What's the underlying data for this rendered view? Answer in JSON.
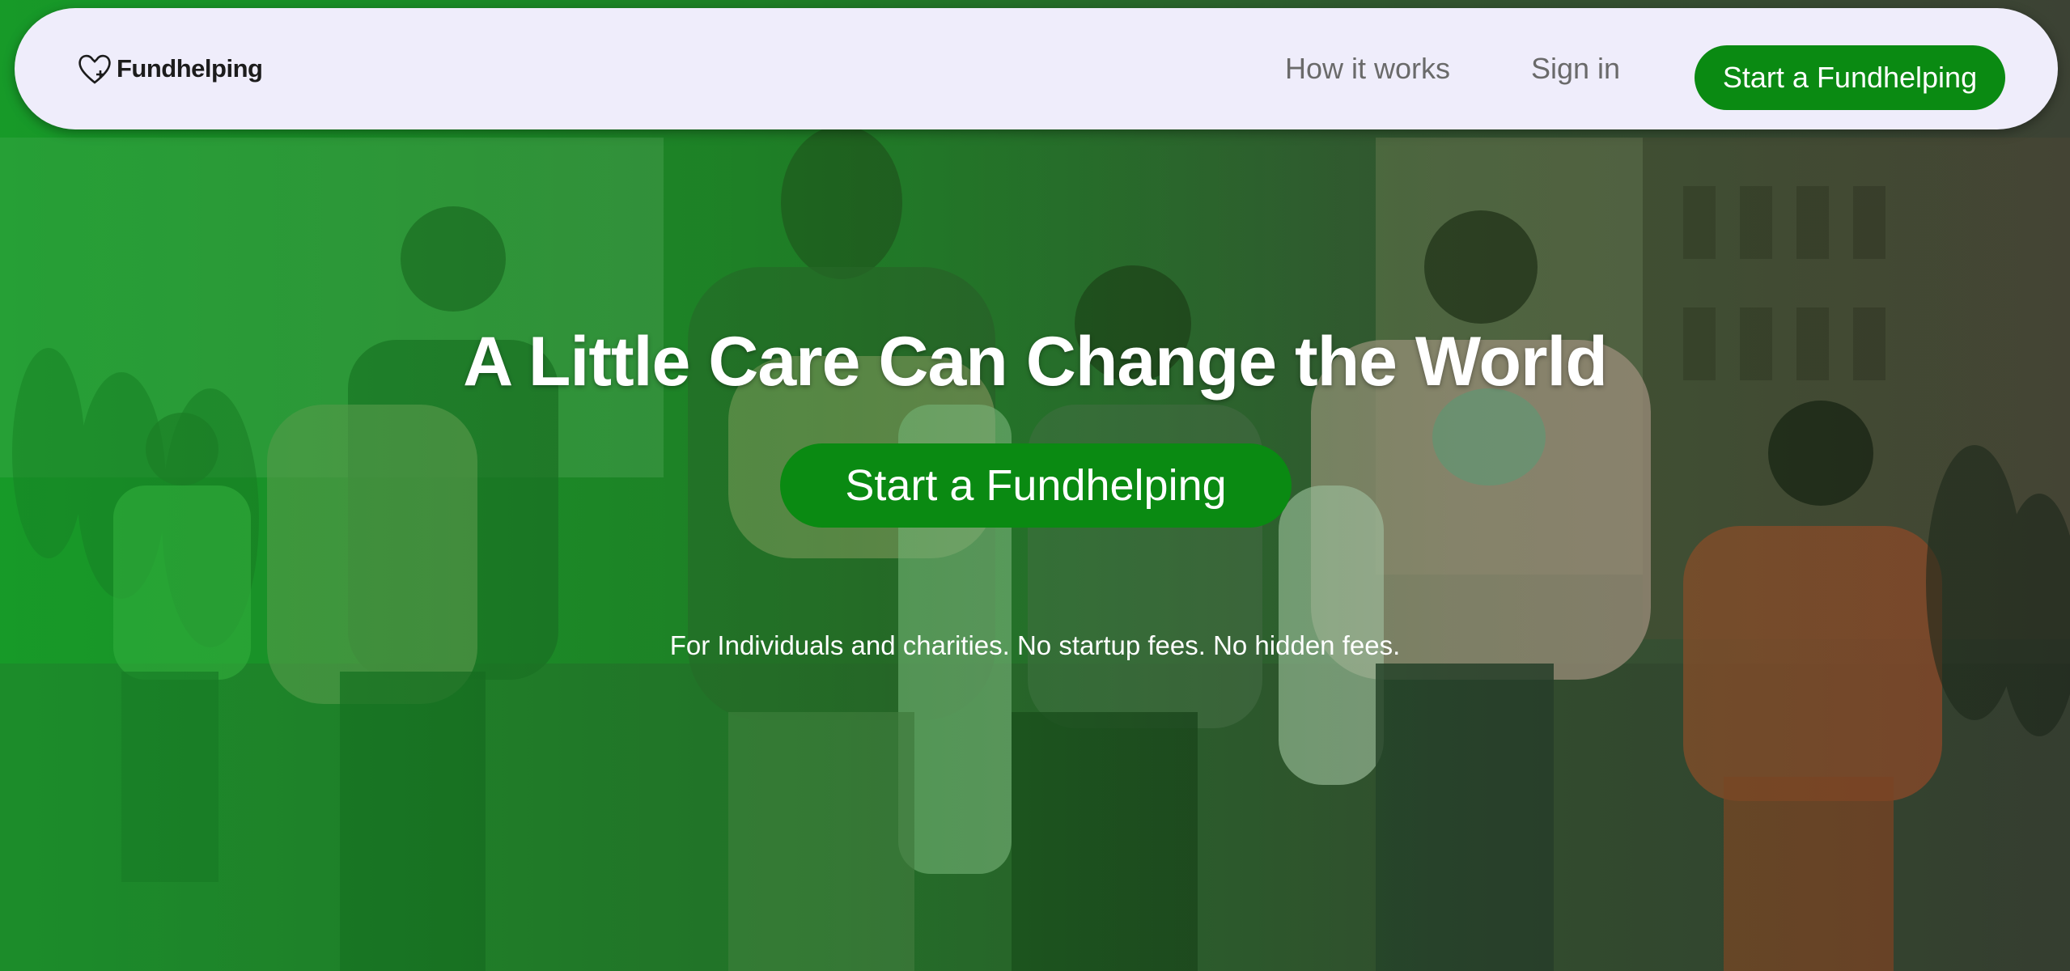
{
  "nav": {
    "brand": "Fundhelping",
    "how_it_works": "How it works",
    "sign_in": "Sign in",
    "cta": "Start a Fundhelping"
  },
  "hero": {
    "headline": "A Little Care Can Change the World",
    "cta": "Start a Fundhelping",
    "subtext": "For Individuals and charities. No startup fees. No hidden fees."
  },
  "colors": {
    "accent_green": "#0a8a12",
    "nav_bg": "#efedfb",
    "nav_link": "#6a6a6a"
  },
  "icons": {
    "brand": "heart-plus-icon"
  }
}
